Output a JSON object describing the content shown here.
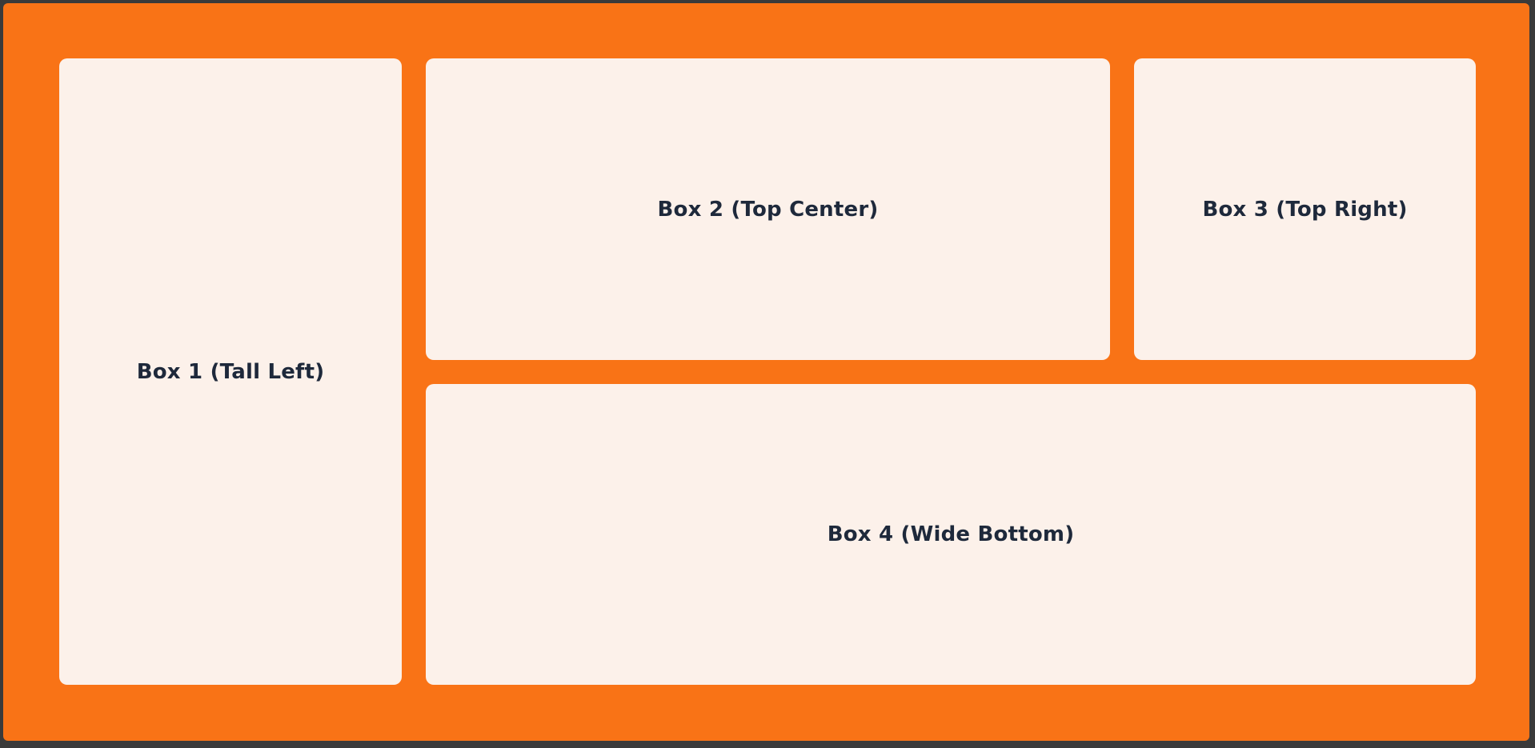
{
  "colors": {
    "outer_background": "#3a3a3a",
    "container_background": "#f97316",
    "box_background": "#fcf1ea",
    "box_text": "#1e293b"
  },
  "boxes": [
    {
      "label": "Box 1 (Tall Left)"
    },
    {
      "label": "Box 2 (Top Center)"
    },
    {
      "label": "Box 3 (Top Right)"
    },
    {
      "label": "Box 4 (Wide Bottom)"
    }
  ]
}
